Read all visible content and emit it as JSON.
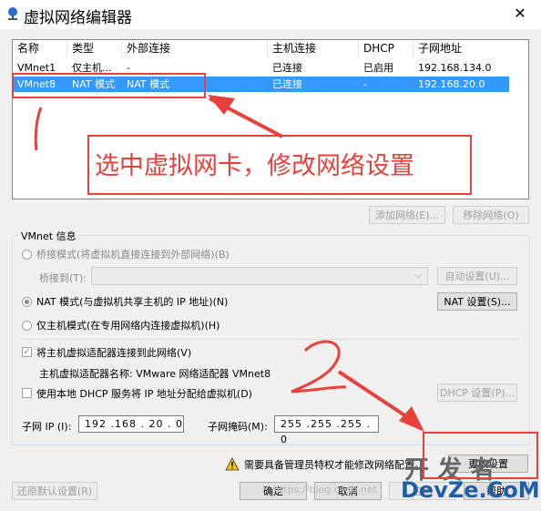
{
  "window": {
    "title": "虚拟网络编辑器",
    "close_glyph": "✕"
  },
  "table": {
    "columns": [
      "名称",
      "类型",
      "外部连接",
      "主机连接",
      "DHCP",
      "子网地址"
    ],
    "rows": [
      [
        "VMnet1",
        "仅主机...",
        "-",
        "已连接",
        "已启用",
        "192.168.134.0"
      ],
      [
        "VMnet8",
        "NAT 模式",
        "NAT 模式",
        "已连接",
        "-",
        "192.168.20.0"
      ]
    ],
    "selected_index": 1
  },
  "buttons": {
    "add_network": "添加网络(E)...",
    "remove_network": "移除网络(O)",
    "auto_settings": "自动设置(U)...",
    "nat_settings": "NAT 设置(S)...",
    "dhcp_settings": "DHCP 设置(P)...",
    "change_settings": "更改设置",
    "restore_defaults": "还原默认设置(R)",
    "ok": "确定",
    "cancel": "取消",
    "apply": "应用",
    "help": "帮助"
  },
  "vmnet_info": {
    "group_label": "VMnet 信息",
    "bridged_label": "桥接模式(将虚拟机直接连接到外部网络)(B)",
    "bridged_to_label": "桥接到(T):",
    "nat_label": "NAT 模式(与虚拟机共享主机的 IP 地址)(N)",
    "hostonly_label": "仅主机模式(在专用网络内连接虚拟机)(H)",
    "connect_adapter_label": "将主机虚拟适配器连接到此网络(V)",
    "adapter_name_label": "主机虚拟适配器名称: VMware 网络适配器 VMnet8",
    "use_dhcp_label": "使用本地 DHCP 服务将 IP 地址分配给虚拟机(D)",
    "subnet_ip_label": "子网 IP (I):",
    "subnet_ip_value": "192 .168 . 20 . 0",
    "subnet_mask_label": "子网掩码(M):",
    "subnet_mask_value": "255 .255 .255 . 0",
    "selected_mode": "nat",
    "connect_adapter_checked": true,
    "use_dhcp_checked": false
  },
  "warning": {
    "text": "需要具备管理员特权才能修改网络配置。",
    "icon": "warning-icon"
  },
  "annotations": {
    "callout_text": "选中虚拟网卡，修改网络设置",
    "mark_1": "1",
    "mark_2": "2",
    "color": "#e8413c"
  },
  "watermark": {
    "top": "开 发 者",
    "bottom": "DevZe.CoM",
    "url_text": "https://blog.csdn.net"
  }
}
